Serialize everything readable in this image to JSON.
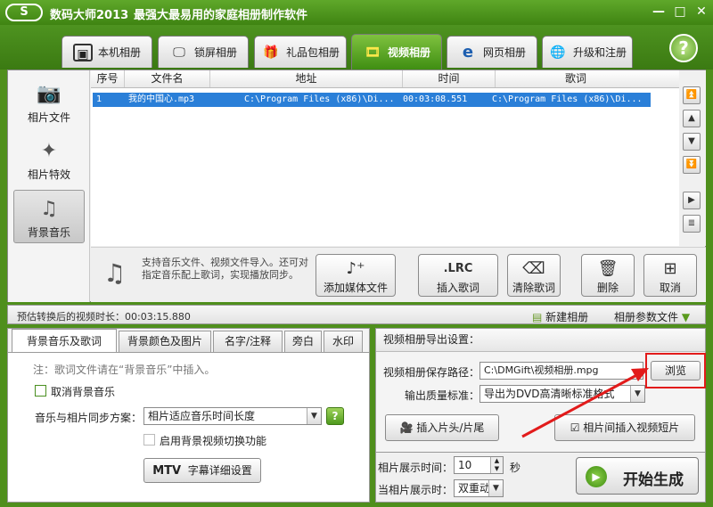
{
  "title": {
    "logo": "S",
    "app_name": "数码大师2013",
    "slogan": "最强大最易用的家庭相册制作软件",
    "min": "—",
    "max": "□",
    "close": "✕"
  },
  "tabs": [
    {
      "label": "本机相册",
      "icon": "photo-frame-icon"
    },
    {
      "label": "锁屏相册",
      "icon": "monitor-icon"
    },
    {
      "label": "礼品包相册",
      "icon": "gift-icon"
    },
    {
      "label": "视频相册",
      "icon": "film-icon"
    },
    {
      "label": "网页相册",
      "icon": "ie-icon"
    },
    {
      "label": "升级和注册",
      "icon": "globe-icon"
    }
  ],
  "help": "?",
  "leftnav": [
    {
      "label": "相片文件"
    },
    {
      "label": "相片特效"
    },
    {
      "label": "背景音乐"
    }
  ],
  "table": {
    "headers": [
      "序号",
      "文件名",
      "地址",
      "时间",
      "歌词"
    ],
    "rows": [
      {
        "index": "1",
        "name": "我的中国心.mp3",
        "path": "C:\\Program Files (x86)\\Di...",
        "time": "00:03:08.551",
        "lyrics": "C:\\Program Files (x86)\\Di..."
      }
    ]
  },
  "tools": {
    "tip": "支持音乐文件、视频文件导入。还可对指定音乐配上歌词，实现播放同步。",
    "add_media": "添加媒体文件",
    "insert_lyric": "插入歌词",
    "lrc": ".LRC",
    "clear_lyric": "清除歌词",
    "delete": "删除",
    "cancel": "取消"
  },
  "info": {
    "estimate": "预估转换后的视频时长：00:03:15.880",
    "new_album": "新建相册",
    "album_params": "相册参数文件"
  },
  "lower_tabs": [
    "背景音乐及歌词",
    "背景颜色及图片",
    "名字/注释",
    "旁白",
    "水印"
  ],
  "music": {
    "note": "注：歌词文件请在“背景音乐”中插入。",
    "cancel_bgm": "取消背景音乐",
    "sync_label": "音乐与相片同步方案：",
    "sync_value": "相片适应音乐时间长度",
    "qmark": "?",
    "enable_video_switch": "启用背景视频切换功能",
    "mtv_label": "MTV",
    "mtv_btn": "字幕详细设置"
  },
  "export": {
    "heading": "视频相册导出设置：",
    "path_label": "视频相册保存路径：",
    "path_value": "C:\\DMGift\\视频相册.mpg",
    "browse": "浏览",
    "quality_label": "输出质量标准：",
    "quality_value": "导出为DVD高清晰标准格式",
    "insert_head_tail": "插入片头/片尾",
    "insert_clip": "相片间插入视频短片"
  },
  "bottom": {
    "display_time_label": "相片展示时间：",
    "display_time_value": "10",
    "seconds": "秒",
    "transition_label": "当相片展示时：",
    "transition_value": "双重动态",
    "start": "开始生成"
  },
  "colors": {
    "accent_green": "#4f8f1c",
    "selection_blue": "#2a7fd8",
    "highlight_red": "#e21b1b"
  }
}
